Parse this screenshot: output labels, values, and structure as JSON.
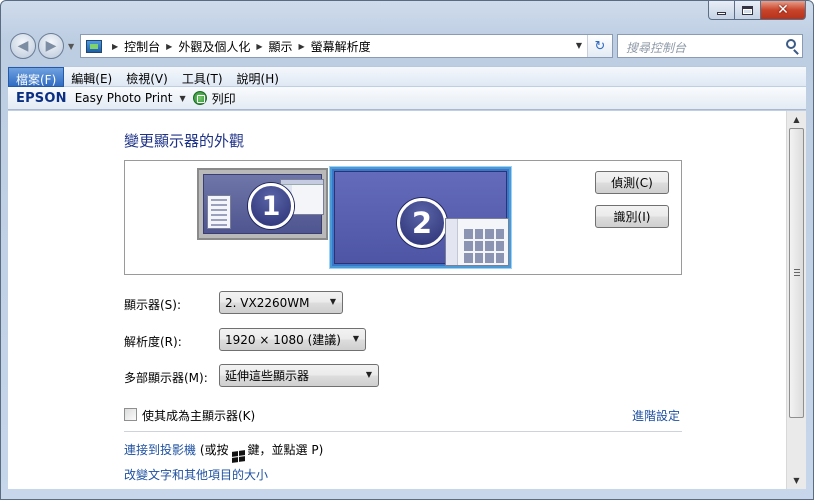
{
  "window": {
    "minimize_label": "minimize",
    "maximize_label": "maximize",
    "close_glyph": "✕"
  },
  "nav": {
    "back_glyph": "◀",
    "forward_glyph": "▶",
    "breadcrumb": [
      "控制台",
      "外觀及個人化",
      "顯示",
      "螢幕解析度"
    ],
    "refresh_glyph": "↻",
    "search_placeholder": "搜尋控制台"
  },
  "menu": [
    "檔案(F)",
    "編輯(E)",
    "檢視(V)",
    "工具(T)",
    "說明(H)"
  ],
  "toolbar": {
    "brand": "EPSON",
    "app": "Easy Photo Print",
    "print_label": "列印"
  },
  "main": {
    "title": "變更顯示器的外觀",
    "monitors": [
      {
        "number": "1",
        "selected": false
      },
      {
        "number": "2",
        "selected": true
      }
    ],
    "detect_button": "偵測(C)",
    "identify_button": "識別(I)",
    "fields": {
      "display_label": "顯示器(S):",
      "display_value": "2. VX2260WM",
      "resolution_label": "解析度(R):",
      "resolution_value": "1920 × 1080 (建議)",
      "multi_label": "多部顯示器(M):",
      "multi_value": "延伸這些顯示器"
    },
    "main_display_checkbox": "使其成為主顯示器(K)",
    "main_display_checked": false,
    "advanced_link": "進階設定",
    "projector_link": "連接到投影機",
    "projector_hint_pre": "(或按",
    "projector_hint_post": "鍵，並點選 P)",
    "text_size_link": "改變文字和其他項目的大小"
  },
  "colors": {
    "link": "#1e50a2",
    "title": "#1e3287",
    "selected_monitor_border": "#4a9ad6"
  }
}
